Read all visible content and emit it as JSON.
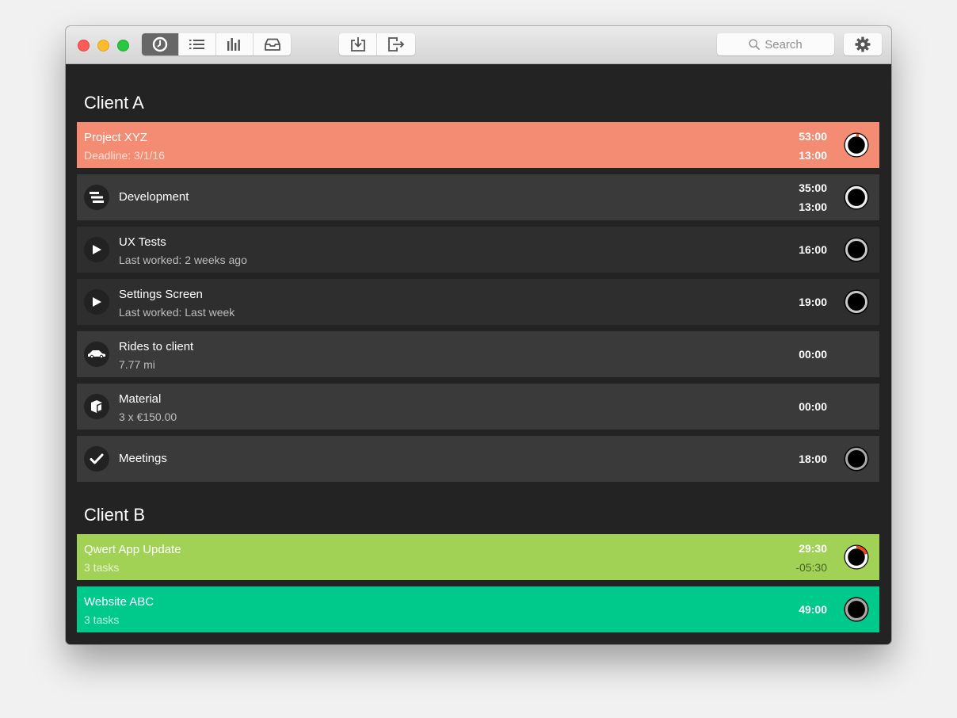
{
  "window": {
    "toolbar": {
      "view_buttons": [
        {
          "name": "timer-view",
          "icon": "clock-icon",
          "active": true
        },
        {
          "name": "list-view",
          "icon": "list-icon",
          "active": false
        },
        {
          "name": "reports-view",
          "icon": "bar-chart-icon",
          "active": false
        },
        {
          "name": "inbox-view",
          "icon": "tray-icon",
          "active": false
        }
      ],
      "io_buttons": [
        {
          "name": "import",
          "icon": "import-tray-icon"
        },
        {
          "name": "export",
          "icon": "export-arrow-icon"
        }
      ],
      "search": {
        "placeholder": "Search"
      },
      "settings": {
        "icon": "gear-icon"
      }
    }
  },
  "colors": {
    "project_xyz": "#f38c72",
    "qwert_app": "#a1d256",
    "website_abc": "#00c98c",
    "task_row": "#3a3a3a",
    "background": "#232323",
    "ring_progress": "#f04a12"
  },
  "clients": [
    {
      "name": "Client A",
      "project": {
        "title": "Project XYZ",
        "subtitle": "Deadline: 3/1/16",
        "time_total": "53:00",
        "time_secondary": "13:00",
        "progress": 0.04
      },
      "tasks": [
        {
          "title": "Development",
          "subtitle": "",
          "icon": "stack-icon",
          "time_total": "35:00",
          "time_secondary": "13:00",
          "has_ring": true
        },
        {
          "title": "UX Tests",
          "subtitle": "Last worked: 2 weeks ago",
          "icon": "play-icon",
          "time": "16:00",
          "has_ring": true
        },
        {
          "title": "Settings Screen",
          "subtitle": "Last worked: Last week",
          "icon": "play-icon",
          "time": "19:00",
          "has_ring": true
        },
        {
          "title": "Rides to client",
          "subtitle": "7.77 mi",
          "icon": "car-icon",
          "time": "00:00",
          "has_ring": false
        },
        {
          "title": "Material",
          "subtitle": "3 x €150.00",
          "icon": "box-icon",
          "time": "00:00",
          "has_ring": false
        },
        {
          "title": "Meetings",
          "subtitle": "",
          "icon": "checkmark-icon",
          "time": "18:00",
          "has_ring": true
        }
      ]
    },
    {
      "name": "Client B",
      "projects": [
        {
          "title": "Qwert App Update",
          "subtitle": "3 tasks",
          "time_total": "29:30",
          "time_secondary": "-05:30",
          "progress": 0.2
        },
        {
          "title": "Website ABC",
          "subtitle": "3 tasks",
          "time": "49:00"
        }
      ]
    }
  ]
}
